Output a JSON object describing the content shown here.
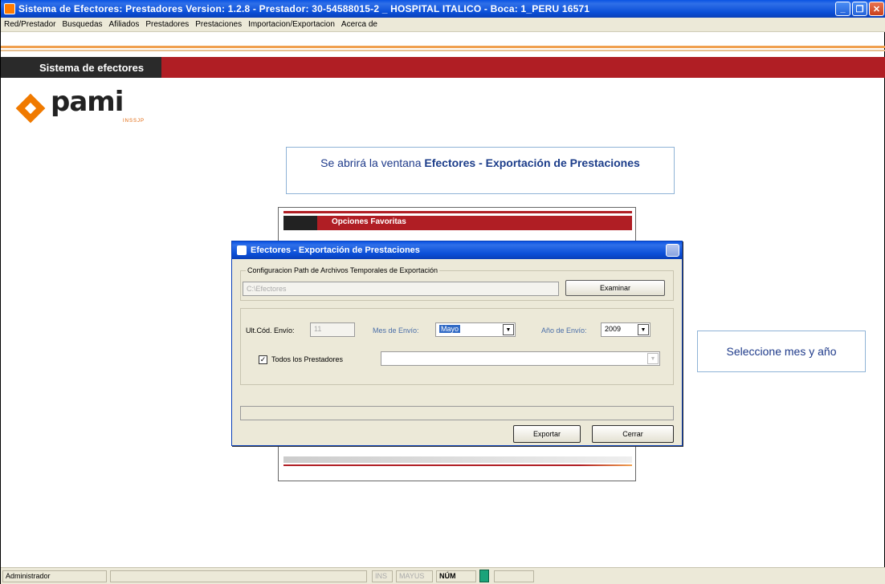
{
  "window": {
    "title": "Sistema de Efectores: Prestadores Version: 1.2.8 - Prestador: 30-54588015-2 _ HOSPITAL ITALICO - Boca: 1_PERU 16571"
  },
  "menu": [
    "Red/Prestador",
    "Busquedas",
    "Afiliados",
    "Prestadores",
    "Prestaciones",
    "Importacion/Exportacion",
    "Acerca de"
  ],
  "header": {
    "tab_label": "Sistema de efectores"
  },
  "logo": {
    "word": "pami",
    "sub": "INSSJP"
  },
  "callouts": {
    "first_prefix": "Se abrirá la ventana ",
    "first_bold": "Efectores - Exportación de Prestaciones",
    "second": "Seleccione mes y año"
  },
  "background_window": {
    "favorites_label": "Opciones Favoritas"
  },
  "dialog": {
    "title": "Efectores - Exportación de Prestaciones",
    "path_group_label": "Configuracion Path de Archivos Temporales de Exportación",
    "path_value": "C:\\Efectores",
    "browse_label": "Examinar",
    "last_code_label": "Ult.Cód. Envío:",
    "last_code_value": "11",
    "month_label": "Mes de Envío:",
    "month_value": "Mayo",
    "year_label": "Año de Envío:",
    "year_value": "2009",
    "all_providers_label": "Todos los Prestadores",
    "all_providers_checked": true,
    "providers_value": "",
    "export_label": "Exportar",
    "close_label": "Cerrar"
  },
  "status": {
    "user": "Administrador",
    "ins": "INS",
    "mayus": "MAYUS",
    "num": "NÚM"
  },
  "colors": {
    "title_blue": "#0a54e3",
    "header_red": "#b01e24",
    "logo_orange": "#f07a00",
    "callout_text": "#1e3a8a"
  }
}
